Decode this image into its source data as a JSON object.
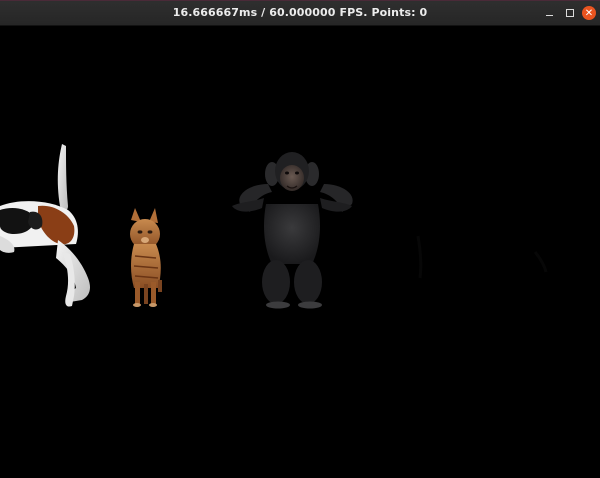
{
  "window": {
    "title": "16.666667ms / 60.000000 FPS. Points: 0",
    "controls": {
      "minimize": "minimize",
      "maximize": "maximize",
      "close": "close"
    }
  },
  "scene": {
    "background": "#000000",
    "objects": [
      {
        "name": "dog",
        "icon": "dog-model"
      },
      {
        "name": "cat",
        "icon": "cat-model"
      },
      {
        "name": "chimpanzee",
        "icon": "chimpanzee-model"
      }
    ]
  }
}
